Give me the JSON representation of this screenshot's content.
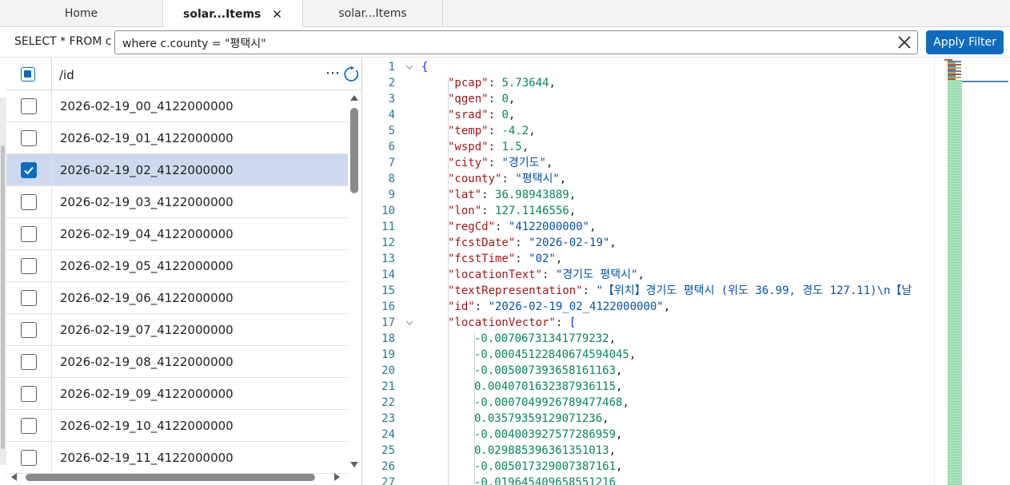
{
  "tabs": [
    {
      "label": "Home",
      "active": false,
      "closable": false
    },
    {
      "label": "solar...Items",
      "active": true,
      "closable": true
    },
    {
      "label": "solar...Items",
      "active": false,
      "closable": false
    }
  ],
  "filter": {
    "prefix": "SELECT * FROM c",
    "query": "where c.county = \"평택시\"",
    "clear_icon": "close-icon",
    "apply_label": "Apply Filter"
  },
  "list": {
    "column_header": "/id",
    "more_icon": "more-horizontal-icon",
    "refresh_icon": "refresh-icon",
    "rows": [
      {
        "id": "2026-02-19_00_4122000000",
        "checked": false
      },
      {
        "id": "2026-02-19_01_4122000000",
        "checked": false
      },
      {
        "id": "2026-02-19_02_4122000000",
        "checked": true
      },
      {
        "id": "2026-02-19_03_4122000000",
        "checked": false
      },
      {
        "id": "2026-02-19_04_4122000000",
        "checked": false
      },
      {
        "id": "2026-02-19_05_4122000000",
        "checked": false
      },
      {
        "id": "2026-02-19_06_4122000000",
        "checked": false
      },
      {
        "id": "2026-02-19_07_4122000000",
        "checked": false
      },
      {
        "id": "2026-02-19_08_4122000000",
        "checked": false
      },
      {
        "id": "2026-02-19_09_4122000000",
        "checked": false
      },
      {
        "id": "2026-02-19_10_4122000000",
        "checked": false
      },
      {
        "id": "2026-02-19_11_4122000000",
        "checked": false
      }
    ]
  },
  "editor": {
    "lines": [
      {
        "n": "1",
        "fold": true,
        "indent": 0,
        "parts": [
          {
            "c": "b",
            "t": "{"
          }
        ]
      },
      {
        "n": "2",
        "indent": 1,
        "parts": [
          {
            "c": "k",
            "t": "\"pcap\""
          },
          {
            "c": "p",
            "t": ": "
          },
          {
            "c": "n",
            "t": "5.73644"
          },
          {
            "c": "p",
            "t": ","
          }
        ]
      },
      {
        "n": "3",
        "indent": 1,
        "parts": [
          {
            "c": "k",
            "t": "\"qgen\""
          },
          {
            "c": "p",
            "t": ": "
          },
          {
            "c": "n",
            "t": "0"
          },
          {
            "c": "p",
            "t": ","
          }
        ]
      },
      {
        "n": "4",
        "indent": 1,
        "parts": [
          {
            "c": "k",
            "t": "\"srad\""
          },
          {
            "c": "p",
            "t": ": "
          },
          {
            "c": "n",
            "t": "0"
          },
          {
            "c": "p",
            "t": ","
          }
        ]
      },
      {
        "n": "5",
        "indent": 1,
        "parts": [
          {
            "c": "k",
            "t": "\"temp\""
          },
          {
            "c": "p",
            "t": ": "
          },
          {
            "c": "n",
            "t": "-4.2"
          },
          {
            "c": "p",
            "t": ","
          }
        ]
      },
      {
        "n": "6",
        "indent": 1,
        "parts": [
          {
            "c": "k",
            "t": "\"wspd\""
          },
          {
            "c": "p",
            "t": ": "
          },
          {
            "c": "n",
            "t": "1.5"
          },
          {
            "c": "p",
            "t": ","
          }
        ]
      },
      {
        "n": "7",
        "indent": 1,
        "parts": [
          {
            "c": "k",
            "t": "\"city\""
          },
          {
            "c": "p",
            "t": ": "
          },
          {
            "c": "s",
            "t": "\"경기도\""
          },
          {
            "c": "p",
            "t": ","
          }
        ]
      },
      {
        "n": "8",
        "indent": 1,
        "parts": [
          {
            "c": "k",
            "t": "\"county\""
          },
          {
            "c": "p",
            "t": ": "
          },
          {
            "c": "s",
            "t": "\"평택시\""
          },
          {
            "c": "p",
            "t": ","
          }
        ]
      },
      {
        "n": "9",
        "indent": 1,
        "parts": [
          {
            "c": "k",
            "t": "\"lat\""
          },
          {
            "c": "p",
            "t": ": "
          },
          {
            "c": "n",
            "t": "36.98943889"
          },
          {
            "c": "p",
            "t": ","
          }
        ]
      },
      {
        "n": "10",
        "indent": 1,
        "parts": [
          {
            "c": "k",
            "t": "\"lon\""
          },
          {
            "c": "p",
            "t": ": "
          },
          {
            "c": "n",
            "t": "127.1146556"
          },
          {
            "c": "p",
            "t": ","
          }
        ]
      },
      {
        "n": "11",
        "indent": 1,
        "parts": [
          {
            "c": "k",
            "t": "\"regCd\""
          },
          {
            "c": "p",
            "t": ": "
          },
          {
            "c": "s",
            "t": "\"4122000000\""
          },
          {
            "c": "p",
            "t": ","
          }
        ]
      },
      {
        "n": "12",
        "indent": 1,
        "parts": [
          {
            "c": "k",
            "t": "\"fcstDate\""
          },
          {
            "c": "p",
            "t": ": "
          },
          {
            "c": "s",
            "t": "\"2026-02-19\""
          },
          {
            "c": "p",
            "t": ","
          }
        ]
      },
      {
        "n": "13",
        "indent": 1,
        "parts": [
          {
            "c": "k",
            "t": "\"fcstTime\""
          },
          {
            "c": "p",
            "t": ": "
          },
          {
            "c": "s",
            "t": "\"02\""
          },
          {
            "c": "p",
            "t": ","
          }
        ]
      },
      {
        "n": "14",
        "indent": 1,
        "parts": [
          {
            "c": "k",
            "t": "\"locationText\""
          },
          {
            "c": "p",
            "t": ": "
          },
          {
            "c": "s",
            "t": "\"경기도 평택시\""
          },
          {
            "c": "p",
            "t": ","
          }
        ]
      },
      {
        "n": "15",
        "indent": 1,
        "parts": [
          {
            "c": "k",
            "t": "\"textRepresentation\""
          },
          {
            "c": "p",
            "t": ": "
          },
          {
            "c": "s",
            "t": "\"【위치】경기도 평택시 (위도 36.99, 경도 127.11)\\n【날"
          }
        ]
      },
      {
        "n": "16",
        "indent": 1,
        "parts": [
          {
            "c": "k",
            "t": "\"id\""
          },
          {
            "c": "p",
            "t": ": "
          },
          {
            "c": "s",
            "t": "\"2026-02-19_02_4122000000\""
          },
          {
            "c": "p",
            "t": ","
          }
        ]
      },
      {
        "n": "17",
        "fold": true,
        "indent": 1,
        "parts": [
          {
            "c": "k",
            "t": "\"locationVector\""
          },
          {
            "c": "p",
            "t": ": "
          },
          {
            "c": "b",
            "t": "["
          }
        ]
      },
      {
        "n": "18",
        "indent": 2,
        "parts": [
          {
            "c": "n",
            "t": "-0.00706731341779232"
          },
          {
            "c": "p",
            "t": ","
          }
        ]
      },
      {
        "n": "19",
        "indent": 2,
        "parts": [
          {
            "c": "n",
            "t": "-0.00045122840674594045"
          },
          {
            "c": "p",
            "t": ","
          }
        ]
      },
      {
        "n": "20",
        "indent": 2,
        "parts": [
          {
            "c": "n",
            "t": "-0.005007393658161163"
          },
          {
            "c": "p",
            "t": ","
          }
        ]
      },
      {
        "n": "21",
        "indent": 2,
        "parts": [
          {
            "c": "n",
            "t": "0.0040701632387936115"
          },
          {
            "c": "p",
            "t": ","
          }
        ]
      },
      {
        "n": "22",
        "indent": 2,
        "parts": [
          {
            "c": "n",
            "t": "-0.0007049926789477468"
          },
          {
            "c": "p",
            "t": ","
          }
        ]
      },
      {
        "n": "23",
        "indent": 2,
        "parts": [
          {
            "c": "n",
            "t": "0.03579359129071236"
          },
          {
            "c": "p",
            "t": ","
          }
        ]
      },
      {
        "n": "24",
        "indent": 2,
        "parts": [
          {
            "c": "n",
            "t": "-0.004003927577286959"
          },
          {
            "c": "p",
            "t": ","
          }
        ]
      },
      {
        "n": "25",
        "indent": 2,
        "parts": [
          {
            "c": "n",
            "t": "0.029885396361351013"
          },
          {
            "c": "p",
            "t": ","
          }
        ]
      },
      {
        "n": "26",
        "indent": 2,
        "parts": [
          {
            "c": "n",
            "t": "-0.005017329007387161"
          },
          {
            "c": "p",
            "t": ","
          }
        ]
      },
      {
        "n": "27",
        "indent": 2,
        "parts": [
          {
            "c": "n",
            "t": "-0.019645409658551216"
          }
        ]
      }
    ]
  },
  "colors": {
    "accent": "#0f6cbd",
    "selected_row": "#cfd9ee",
    "json_key": "#a31515",
    "json_string": "#0451a5",
    "json_number": "#098658",
    "line_number": "#237893",
    "bracket": "#0431fa"
  }
}
